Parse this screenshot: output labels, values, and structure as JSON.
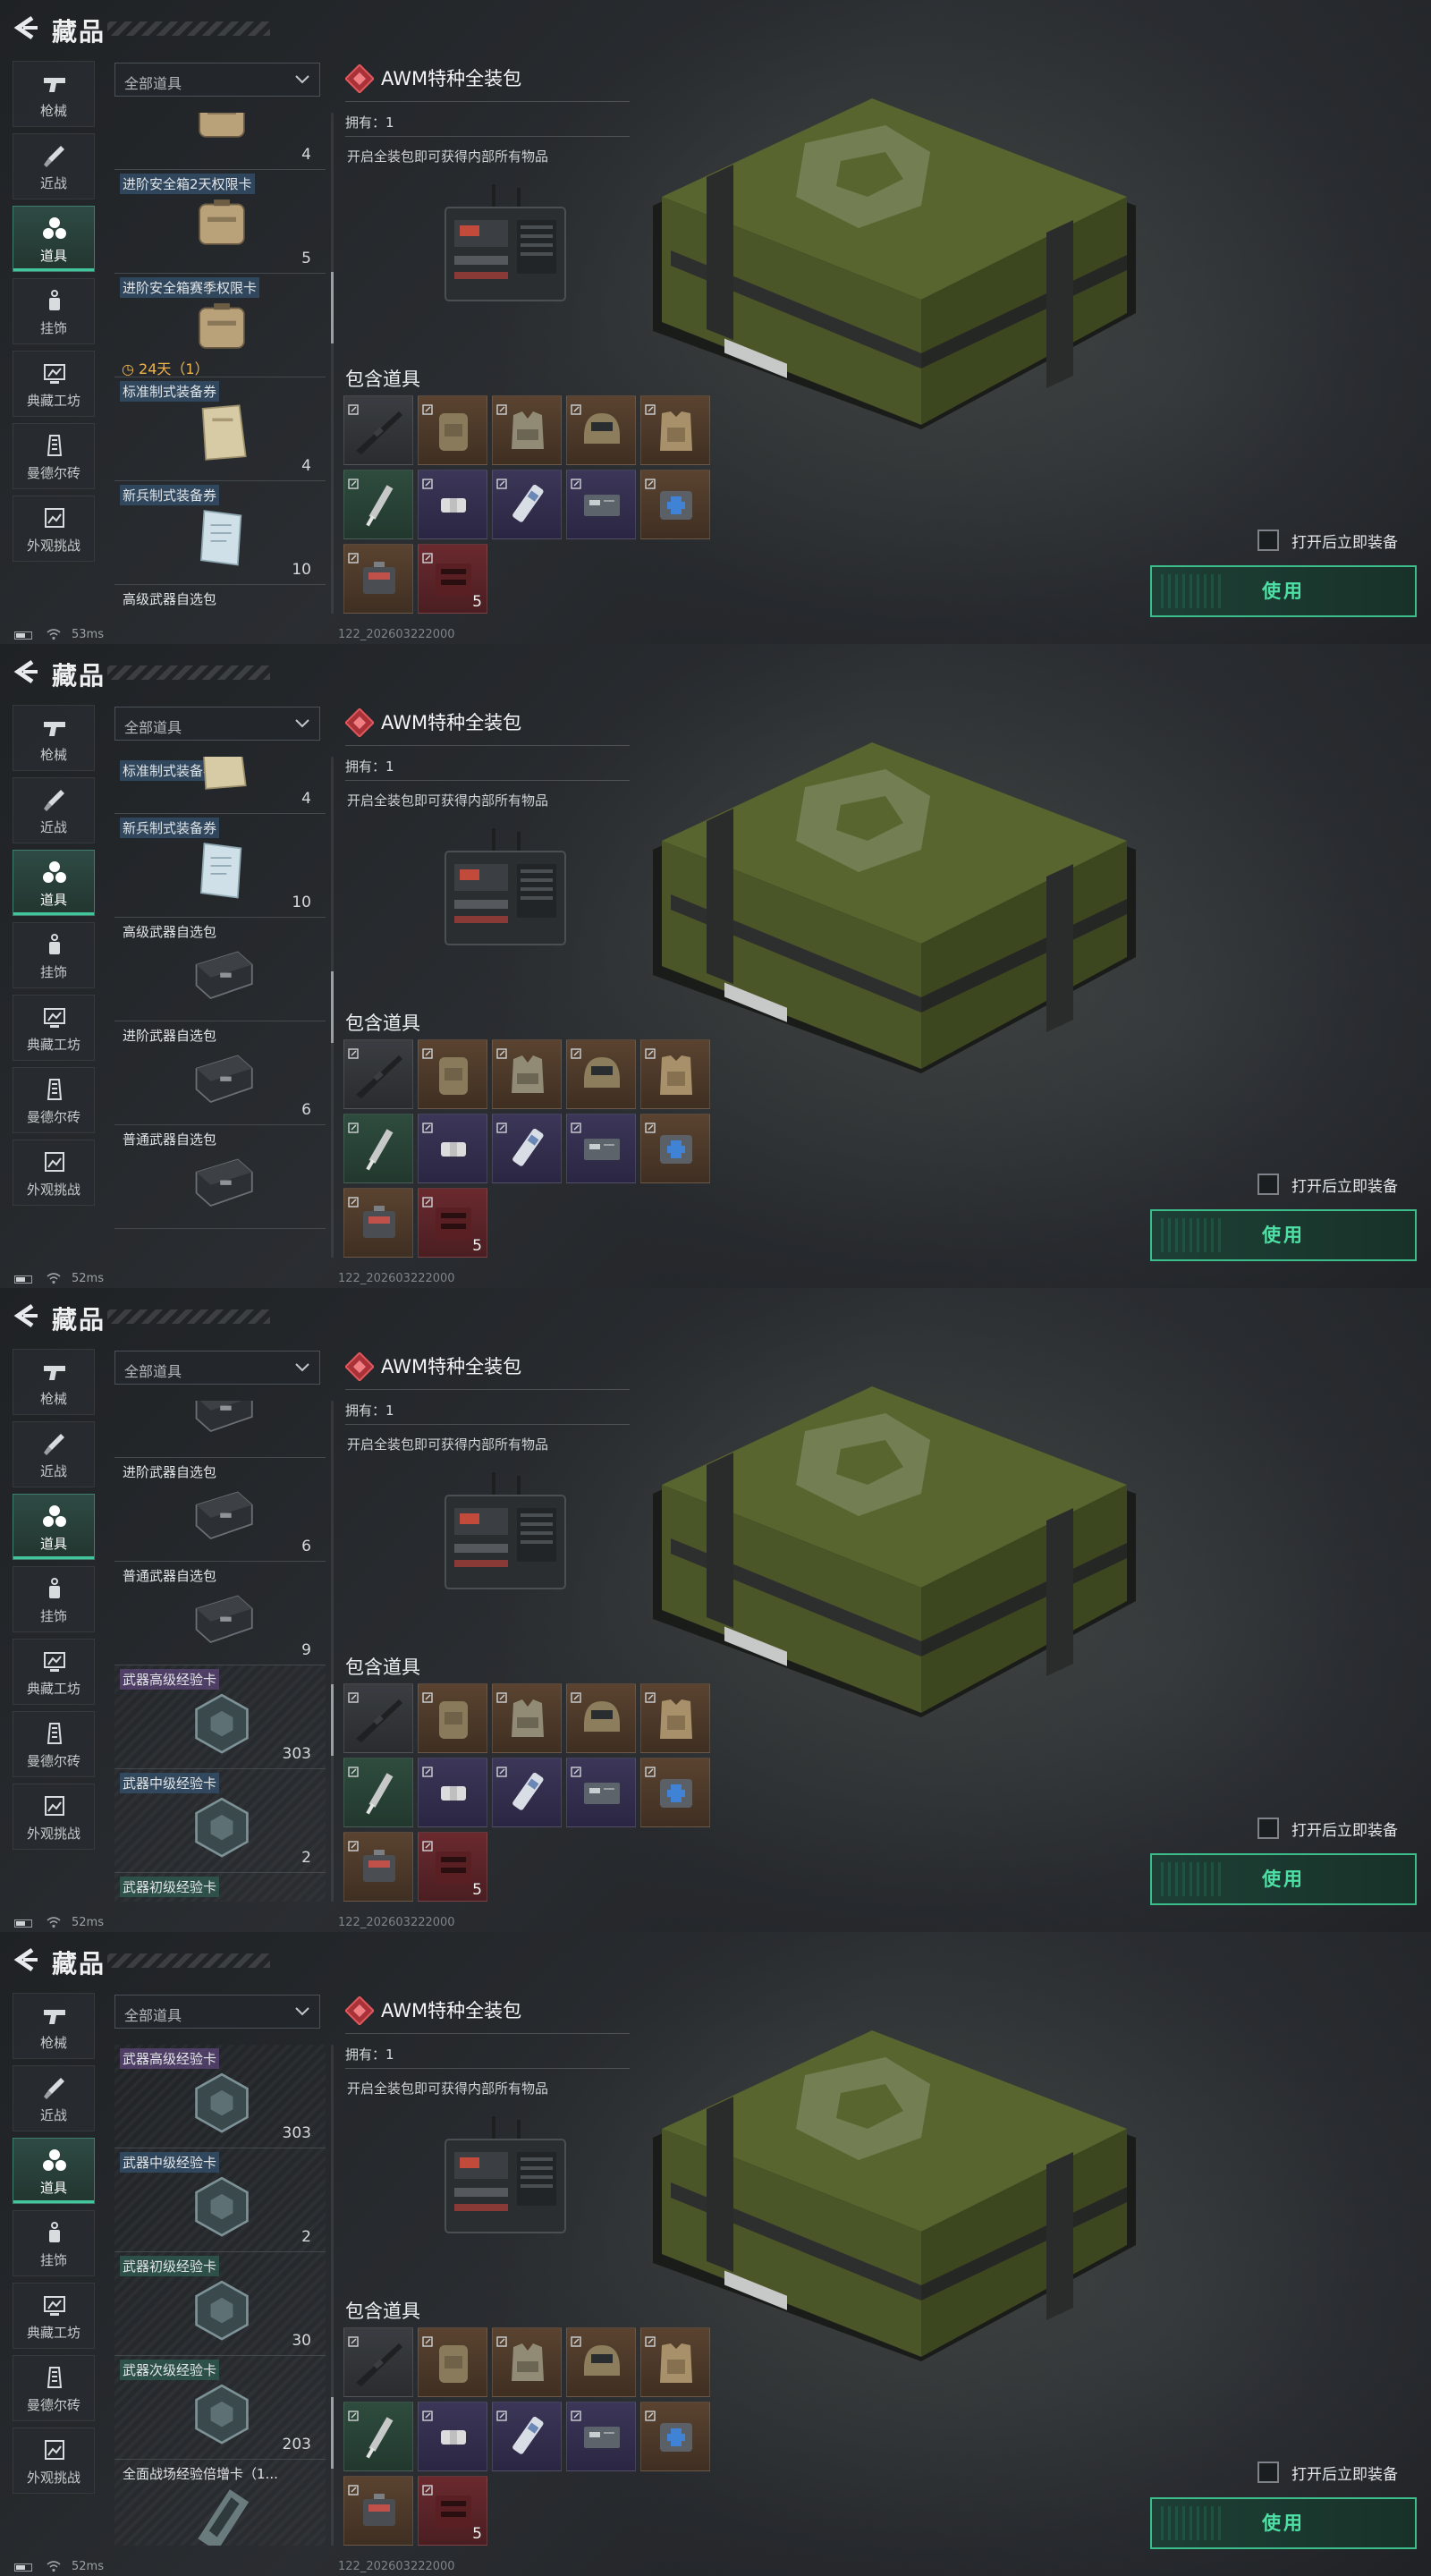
{
  "header": {
    "title": "藏品"
  },
  "filter": {
    "label": "全部道具"
  },
  "nav": [
    {
      "label": "枪械",
      "icon": "gun-icon"
    },
    {
      "label": "近战",
      "icon": "knife-icon"
    },
    {
      "label": "道具",
      "icon": "items-icon"
    },
    {
      "label": "挂饰",
      "icon": "charm-icon"
    },
    {
      "label": "典藏工坊",
      "icon": "workshop-icon"
    },
    {
      "label": "曼德尔砖",
      "icon": "brick-icon"
    },
    {
      "label": "外观挑战",
      "icon": "challenge-icon"
    }
  ],
  "detail": {
    "title": "AWM特种全装包",
    "owned": "拥有：1",
    "desc": "开启全装包即可获得内部所有物品",
    "contents_title": "包含道具",
    "contents": [
      {
        "q": "gray",
        "icon": "rifle-icon"
      },
      {
        "q": "brown",
        "icon": "backpack-icon"
      },
      {
        "q": "brown",
        "icon": "chest-rig-icon"
      },
      {
        "q": "brown",
        "icon": "helmet-icon"
      },
      {
        "q": "brown",
        "icon": "armor-vest-icon"
      },
      {
        "q": "green",
        "icon": "syringe-icon"
      },
      {
        "q": "purple",
        "icon": "bandage-icon"
      },
      {
        "q": "purple",
        "icon": "injector-icon"
      },
      {
        "q": "purple",
        "icon": "keycard-icon"
      },
      {
        "q": "brown",
        "icon": "medkit-icon"
      },
      {
        "q": "brown",
        "icon": "ammo-box-icon"
      },
      {
        "q": "red",
        "icon": "ammo-crate-icon",
        "count": "5"
      }
    ],
    "auto_equip": "打开后立即装备",
    "use": "使用"
  },
  "panels": [
    {
      "ping": "53ms",
      "build": "122_202603222000",
      "thumb": 0.37,
      "rows": [
        {
          "name": "",
          "count": "4",
          "img": "case",
          "partial": true
        },
        {
          "name": "进阶安全箱2天权限卡",
          "count": "5",
          "img": "case",
          "tag": "blue"
        },
        {
          "name": "进阶安全箱赛季权限卡",
          "count": "",
          "img": "case",
          "tag": "blue",
          "timer": "24天（1）"
        },
        {
          "name": "标准制式装备券",
          "count": "4",
          "img": "ticket",
          "tag": "blue"
        },
        {
          "name": "新兵制式装备券",
          "count": "10",
          "img": "paper",
          "tag": "blue"
        },
        {
          "name": "高级武器自选包",
          "count": "",
          "img": "weapon-case"
        }
      ]
    },
    {
      "ping": "52ms",
      "build": "122_202603222000",
      "thumb": 0.5,
      "rows": [
        {
          "name": "标准制式装备券",
          "count": "4",
          "img": "ticket",
          "tag": "blue",
          "partial": true
        },
        {
          "name": "新兵制式装备券",
          "count": "10",
          "img": "paper",
          "tag": "blue"
        },
        {
          "name": "高级武器自选包",
          "count": "",
          "img": "weapon-case"
        },
        {
          "name": "进阶武器自选包",
          "count": "6",
          "img": "weapon-case"
        },
        {
          "name": "普通武器自选包",
          "count": "",
          "img": "weapon-case"
        }
      ]
    },
    {
      "ping": "52ms",
      "build": "122_202603222000",
      "thumb": 0.66,
      "rows": [
        {
          "name": "",
          "count": "",
          "img": "weapon-case",
          "partial": true
        },
        {
          "name": "进阶武器自选包",
          "count": "6",
          "img": "weapon-case"
        },
        {
          "name": "普通武器自选包",
          "count": "9",
          "img": "weapon-case"
        },
        {
          "name": "武器高级经验卡",
          "count": "303",
          "img": "hex",
          "tag": "purple",
          "tex": true
        },
        {
          "name": "武器中级经验卡",
          "count": "2",
          "img": "hex",
          "tag": "blue",
          "tex": true
        },
        {
          "name": "武器初级经验卡",
          "count": "",
          "img": "hex",
          "tag": "green",
          "tex": true
        }
      ]
    },
    {
      "ping": "52ms",
      "build": "122_202603222000",
      "thumb": 0.82,
      "rows": [
        {
          "name": "武器高级经验卡",
          "count": "303",
          "img": "hex",
          "tag": "purple",
          "tex": true
        },
        {
          "name": "武器中级经验卡",
          "count": "2",
          "img": "hex",
          "tag": "blue",
          "tex": true
        },
        {
          "name": "武器初级经验卡",
          "count": "30",
          "img": "hex",
          "tag": "green",
          "tex": true
        },
        {
          "name": "武器次级经验卡",
          "count": "203",
          "img": "hex",
          "tag": "green",
          "tex": true
        },
        {
          "name": "全面战场经验倍增卡（1...",
          "count": "",
          "img": "card",
          "tex": true
        }
      ]
    }
  ],
  "colors": {
    "accent": "#3bbd8c",
    "use_text": "#4ee0a6",
    "timer": "#f0b44c",
    "badge_red": "#c8454a"
  }
}
